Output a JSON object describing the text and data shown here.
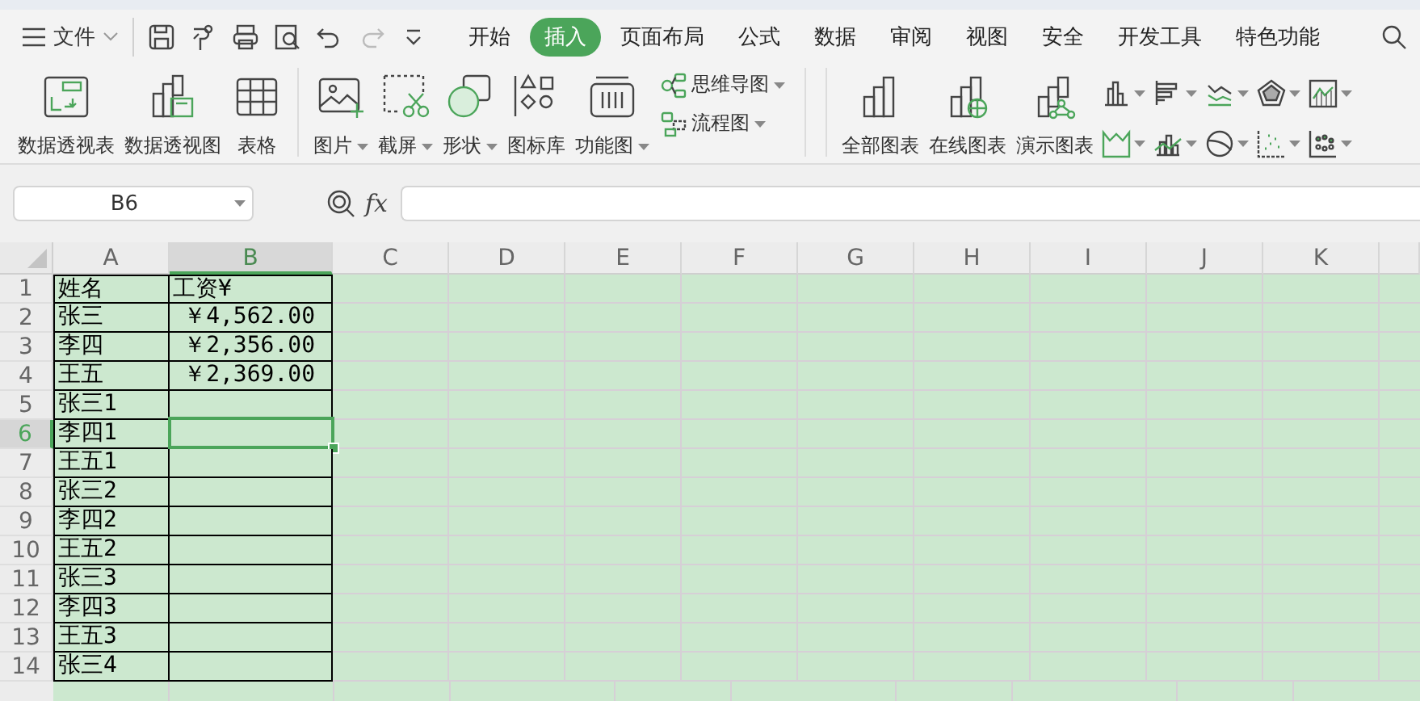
{
  "menu": {
    "file_label": "文件",
    "quick_access": [
      {
        "disabled": false
      },
      {
        "disabled": false
      },
      {
        "disabled": false
      },
      {
        "disabled": false
      },
      {
        "disabled": false
      },
      {
        "disabled": true
      },
      {
        "disabled": false
      }
    ],
    "tabs": [
      {
        "label": "开始",
        "selected": false
      },
      {
        "label": "插入",
        "selected": true
      },
      {
        "label": "页面布局",
        "selected": false
      },
      {
        "label": "公式",
        "selected": false
      },
      {
        "label": "数据",
        "selected": false
      },
      {
        "label": "审阅",
        "selected": false
      },
      {
        "label": "视图",
        "selected": false
      },
      {
        "label": "安全",
        "selected": false
      },
      {
        "label": "开发工具",
        "selected": false
      },
      {
        "label": "特色功能",
        "selected": false
      }
    ]
  },
  "ribbon": {
    "groups": [
      {
        "kind": "large",
        "items": [
          {
            "label": "数据透视表",
            "dropdown": false
          },
          {
            "label": "数据透视图",
            "dropdown": false
          },
          {
            "label": "表格",
            "dropdown": false
          }
        ]
      },
      {
        "kind": "large",
        "items": [
          {
            "label": "图片",
            "dropdown": true
          },
          {
            "label": "截屏",
            "dropdown": true
          },
          {
            "label": "形状",
            "dropdown": true
          },
          {
            "label": "图标库",
            "dropdown": false
          },
          {
            "label": "功能图",
            "dropdown": true
          }
        ]
      },
      {
        "kind": "small",
        "items": [
          {
            "label": "思维导图",
            "dropdown": true
          },
          {
            "label": "流程图",
            "dropdown": true
          }
        ]
      },
      {
        "kind": "large",
        "items": [
          {
            "label": "全部图表",
            "dropdown": false
          },
          {
            "label": "在线图表",
            "dropdown": false
          },
          {
            "label": "演示图表",
            "dropdown": false
          }
        ]
      },
      {
        "kind": "mini",
        "items": [
          {
            "dropdown": true
          },
          {
            "dropdown": true
          },
          {
            "dropdown": true
          },
          {
            "dropdown": true
          },
          {
            "dropdown": true
          },
          {
            "dropdown": true
          },
          {
            "dropdown": true
          },
          {
            "dropdown": true
          },
          {
            "dropdown": true
          },
          {
            "dropdown": true
          }
        ]
      }
    ]
  },
  "formula_bar": {
    "name_box": "B6",
    "fx_label": "fx"
  },
  "sheet": {
    "columns": [
      {
        "label": "A",
        "selected": false
      },
      {
        "label": "B",
        "selected": true
      },
      {
        "label": "C",
        "selected": false
      },
      {
        "label": "D",
        "selected": false
      },
      {
        "label": "E",
        "selected": false
      },
      {
        "label": "F",
        "selected": false
      },
      {
        "label": "G",
        "selected": false
      },
      {
        "label": "H",
        "selected": false
      },
      {
        "label": "I",
        "selected": false
      },
      {
        "label": "J",
        "selected": false
      },
      {
        "label": "K",
        "selected": false
      }
    ],
    "rows": [
      {
        "number": "1",
        "selected": false,
        "cells": [
          "姓名",
          "工资¥"
        ]
      },
      {
        "number": "2",
        "selected": false,
        "cells": [
          "张三",
          "￥4,562.00"
        ]
      },
      {
        "number": "3",
        "selected": false,
        "cells": [
          "李四",
          "￥2,356.00"
        ]
      },
      {
        "number": "4",
        "selected": false,
        "cells": [
          "王五",
          "￥2,369.00"
        ]
      },
      {
        "number": "5",
        "selected": false,
        "cells": [
          "张三1",
          ""
        ]
      },
      {
        "number": "6",
        "selected": true,
        "cells": [
          "李四1",
          ""
        ]
      },
      {
        "number": "7",
        "selected": false,
        "cells": [
          "王五1",
          ""
        ]
      },
      {
        "number": "8",
        "selected": false,
        "cells": [
          "张三2",
          ""
        ]
      },
      {
        "number": "9",
        "selected": false,
        "cells": [
          "李四2",
          ""
        ]
      },
      {
        "number": "10",
        "selected": false,
        "cells": [
          "王五2",
          ""
        ]
      },
      {
        "number": "11",
        "selected": false,
        "cells": [
          "张三3",
          ""
        ]
      },
      {
        "number": "12",
        "selected": false,
        "cells": [
          "李四3",
          ""
        ]
      },
      {
        "number": "13",
        "selected": false,
        "cells": [
          "王五3",
          ""
        ]
      },
      {
        "number": "14",
        "selected": false,
        "cells": [
          "张三4",
          ""
        ]
      }
    ]
  }
}
